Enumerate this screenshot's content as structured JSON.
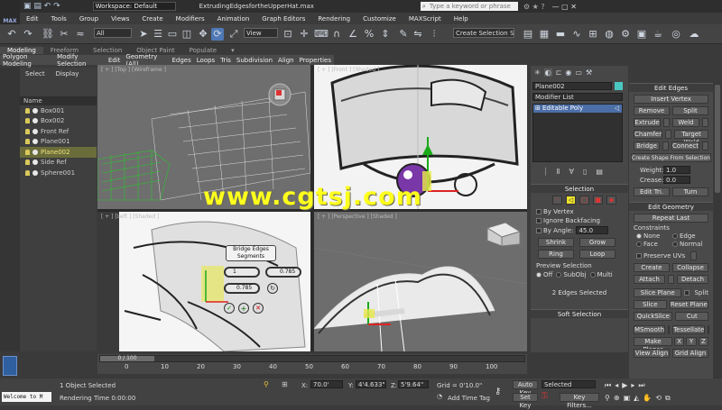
{
  "app": {
    "logo": "MAX",
    "workspace": "Workspace: Default",
    "file_title": "ExtrudingEdgesfortheUpperHat.max",
    "search_placeholder": "Type a keyword or phrase"
  },
  "menu": [
    "Edit",
    "Tools",
    "Group",
    "Views",
    "Create",
    "Modifiers",
    "Animation",
    "Graph Editors",
    "Rendering",
    "Customize",
    "MAXScript",
    "Help"
  ],
  "toolbar": {
    "filter_select": "All",
    "view_select": "View",
    "selection_set": "Create Selection Se"
  },
  "ribbon": {
    "tabs": [
      {
        "label": "Modeling",
        "active": true
      },
      {
        "label": "Freeform"
      },
      {
        "label": "Selection"
      },
      {
        "label": "Object Paint"
      },
      {
        "label": "Populate"
      }
    ],
    "row": [
      "Polygon Modeling",
      "Modify Selection",
      "Edit",
      "Geometry (All)",
      "Edges",
      "Loops",
      "Tris",
      "Subdivision",
      "Align",
      "Properties"
    ]
  },
  "scene": {
    "tabs": [
      "Select",
      "Display"
    ],
    "name_header": "Name",
    "items": [
      {
        "label": "Box001",
        "type": "box"
      },
      {
        "label": "Box002",
        "type": "box"
      },
      {
        "label": "Front Ref",
        "type": "ref"
      },
      {
        "label": "Plane001",
        "type": "plane"
      },
      {
        "label": "Plane002",
        "type": "plane",
        "selected": true
      },
      {
        "label": "Side Ref",
        "type": "ref"
      },
      {
        "label": "Sphere001",
        "type": "sphere"
      }
    ]
  },
  "viewports": {
    "top_left": "[ + ] [Top ] [Wireframe ]",
    "top_right": "[ + ] [Front ] [Shaded ]",
    "bottom_left": "[ + ] [Left ] [Shaded ]",
    "bottom_right": "[ + ] [Perspective ] [Shaded ]"
  },
  "caddy": {
    "title": "Bridge Edges",
    "subtitle": "Segments",
    "segments": "1",
    "taper": "0.785",
    "bias": "0.785"
  },
  "watermark": "www.cgtsj.com",
  "command_panel": {
    "object_name": "Plane002",
    "modifier_list": "Modifier List",
    "stack_item": "Editable Poly",
    "selection": {
      "title": "Selection",
      "by_vertex": "By Vertex",
      "ignore_backfacing": "Ignore Backfacing",
      "by_angle": "By Angle:",
      "angle_value": "45.0",
      "shrink": "Shrink",
      "grow": "Grow",
      "ring": "Ring",
      "loop": "Loop",
      "preview": "Preview Selection",
      "preview_options": [
        "Off",
        "SubObj",
        "Multi"
      ],
      "status": "2 Edges Selected"
    },
    "soft_selection": "Soft Selection"
  },
  "edit_edges": {
    "title": "Edit Edges",
    "insert_vertex": "Insert Vertex",
    "remove": "Remove",
    "split": "Split",
    "extrude": "Extrude",
    "weld": "Weld",
    "chamfer": "Chamfer",
    "target_weld": "Target Weld",
    "bridge": "Bridge",
    "connect": "Connect",
    "create_shape": "Create Shape From Selection",
    "weight_label": "Weight:",
    "weight_value": "1.0",
    "crease_label": "Crease:",
    "crease_value": "0.0",
    "edit_tri": "Edit Tri.",
    "turn": "Turn"
  },
  "edit_geometry": {
    "title": "Edit Geometry",
    "repeat_last": "Repeat Last",
    "constraints": "Constraints",
    "none": "None",
    "edge": "Edge",
    "face": "Face",
    "normal": "Normal",
    "preserve_uvs": "Preserve UVs",
    "create": "Create",
    "collapse": "Collapse",
    "attach": "Attach",
    "detach": "Detach",
    "slice_plane": "Slice Plane",
    "split": "Split",
    "slice": "Slice",
    "reset_plane": "Reset Plane",
    "quickslice": "QuickSlice",
    "cut": "Cut",
    "msmooth": "MSmooth",
    "tessellate": "Tessellate",
    "make_planar": "Make Planar",
    "x": "X",
    "y": "Y",
    "z": "Z",
    "view_align": "View Align",
    "grid_align": "Grid Align"
  },
  "timeline": {
    "frame": "0 / 100",
    "ticks": [
      "0",
      "10",
      "20",
      "30",
      "40",
      "50",
      "60",
      "70",
      "80",
      "90",
      "100"
    ]
  },
  "status": {
    "welcome": "Welcome to M",
    "selected": "1 Object Selected",
    "rendering_time": "Rendering Time  0:00:00",
    "x": "70.0'",
    "y": "4'4.633\"",
    "z": "5'9.64\"",
    "grid": "Grid = 0'10.0\"",
    "add_time_tag": "Add Time Tag",
    "auto_key": "Auto Key",
    "set_key": "Set Key",
    "key_mode": "Selected",
    "key_filters": "Key Filters..."
  },
  "colors": {
    "accent_select": "#f2e27c",
    "watermark": "#ffff1e",
    "gizmo_purple": "#7a37a8"
  }
}
